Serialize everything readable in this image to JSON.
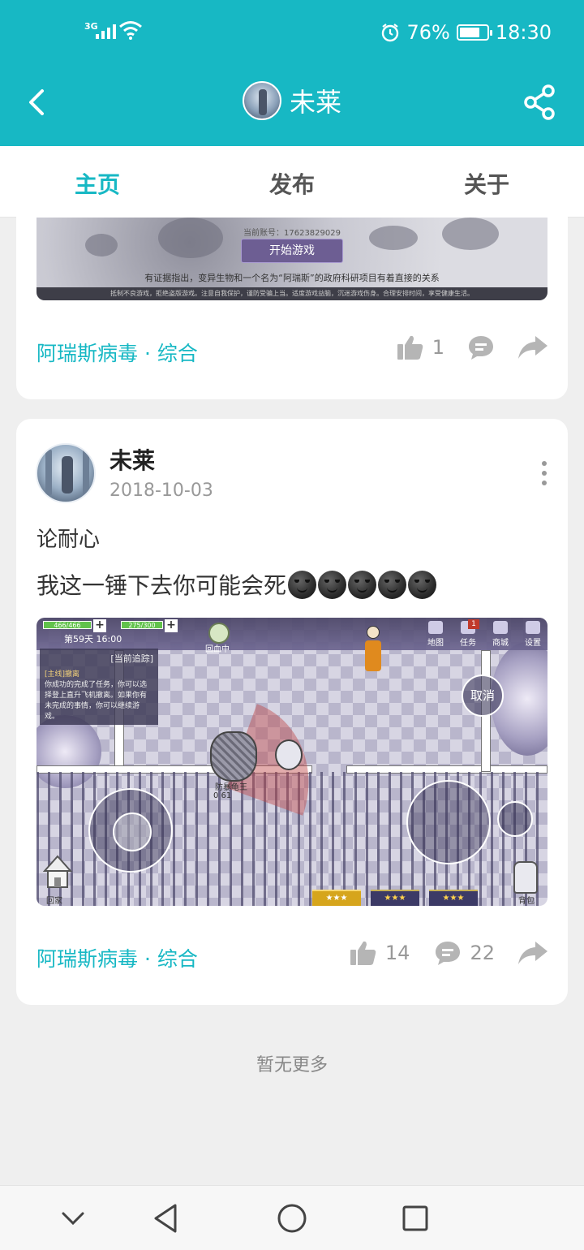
{
  "status_bar": {
    "network": "3G",
    "battery_percent": "76%",
    "time": "18:30",
    "battery_level": 0.76
  },
  "title_bar": {
    "title": "未莱",
    "back_icon": "chevron-left-icon",
    "share_icon": "share-icon"
  },
  "tabs": [
    {
      "label": "主页",
      "active": true
    },
    {
      "label": "发布",
      "active": false
    },
    {
      "label": "关于",
      "active": false
    }
  ],
  "post1": {
    "screenshot": {
      "account_text": "当前账号：17623829029",
      "start_button": "开始游戏",
      "story_text": "有证据指出，变异生物和一个名为“阿瑞斯”的政府科研项目有着直接的关系",
      "footer_text": "抵制不良游戏，拒绝盗版游戏。注意自我保护，谨防受骗上当。适度游戏益脑，沉迷游戏伤身。合理安排时间，享受健康生活。"
    },
    "tag": "阿瑞斯病毒 · 综合",
    "likes": "1"
  },
  "post2": {
    "author": "未莱",
    "date": "2018-10-03",
    "title": "论耐心",
    "body": "我这一锤下去你可能会死",
    "emoji_count": 5,
    "game": {
      "hp": "466/466",
      "mp": "275/300",
      "day": "第59天 16:00",
      "quest_header": "[当前追踪]",
      "quest_title": "[主线]撤离",
      "quest_text": "你成功的完成了任务，你可以选择登上直升飞机撤离。如果你有未完成的事情，你可以继续游戏。",
      "revive_label": "回血中",
      "menu": [
        "地图",
        "任务",
        "商城",
        "设置"
      ],
      "task_badge": "1",
      "cancel": "取消",
      "boss_name": "防暴龟王",
      "boss_stats": "0   61",
      "home": "回家",
      "bag": "背包",
      "slots": [
        "★★★",
        "★★★",
        "★★★"
      ]
    },
    "tag": "阿瑞斯病毒 · 综合",
    "likes": "14",
    "comments": "22"
  },
  "no_more": "暂无更多",
  "nav": [
    "chevron-down-icon",
    "back-triangle-icon",
    "home-circle-icon",
    "recents-square-icon"
  ],
  "colors": {
    "accent": "#17b8c4",
    "background": "#efefef"
  }
}
